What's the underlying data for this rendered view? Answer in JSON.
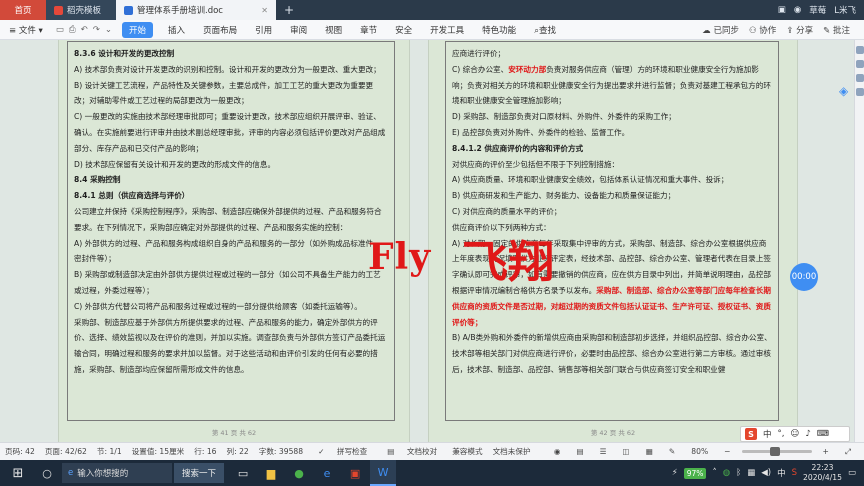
{
  "tabs": {
    "home": "首页",
    "template": "稻壳模板",
    "document": "管理体系手册培训.doc",
    "new_tab": "+"
  },
  "title_right": {
    "user": "草莓",
    "user2": "L米飞"
  },
  "ribbon": {
    "file": "文件",
    "start": "开始",
    "insert": "插入",
    "layout": "页面布局",
    "reference": "引用",
    "review": "审阅",
    "view": "视图",
    "chapter": "章节",
    "security": "安全",
    "dev_tools": "开发工具",
    "features": "特色功能",
    "search": "查找",
    "sync": "已同步",
    "collab": "协作",
    "share": "分享",
    "comment": "批注"
  },
  "page_left": {
    "lines": [
      {
        "t": "8.3.6 设计和开发的更改控制",
        "c": "h"
      },
      {
        "t": "A)  技术部负责对设计开发更改的识别和控制。设计和开发的更改分为一般更改、重大更改；"
      },
      {
        "t": "B)  设计关键工艺流程，产品特性及关键参数，主要总成件，加工工艺的重大更改为重要更改；对辅助零件或工艺过程的局部更改为一般更改；"
      },
      {
        "t": "C)  一般更改的实施由技术部经理审批即可；重要设计更改，技术部应组织开展评审、验证、确认。在实施前要进行评审并由技术副总经理审批，评审的内容必须包括评价更改对产品组成部分、库存产品和已交付产品的影响；"
      },
      {
        "t": "D)  技术部应保留有关设计和开发的更改的形成文件的信息。"
      },
      {
        "t": "8.4 采购控制",
        "c": "h"
      },
      {
        "t": "8.4.1 总则（供应商选择与评价）",
        "c": "h"
      },
      {
        "t": "    公司建立并保持《采购控制程序》，采购部、制造部应确保外部提供的过程、产品和服务符合要求。在下列情况下，采购部应确定对外部提供的过程、产品和服务实施的控制："
      },
      {
        "t": "A)  外部供方的过程、产品和服务构成组织自身的产品和服务的一部分（如外购成品标准件、密封件等）；"
      },
      {
        "t": "B)  采购部或制造部决定由外部供方提供过程或过程的一部分（如公司不具备生产能力的工艺或过程，外委过程等）；"
      },
      {
        "t": "C)  外部供方代替公司将产品和服务过程或过程的一部分提供给顾客（如委托运输等）。"
      },
      {
        "t": "    采购部、制造部应基于外部供方所提供要求的过程、产品和服务的能力，确定外部供方的评价、选择、绩效监视以及在评价的准则，并加以实施。调查部负责与外部供方签订产品委托运输合同，明确过程和服务的要求并加以监督。对于这些活动和由评价引发的任何有必要的措施，采购部、制造部均应保留所需形成文件的信息。"
      }
    ],
    "footer": "第 41 页 共 62"
  },
  "page_right": {
    "lines": [
      {
        "t": "应商进行评价；"
      },
      {
        "t": "C)  综合办公室、",
        "r": "安环动力部",
        "t2": "负责对服务供应商（管理）方的环境和职业健康安全行为施加影响；负责对相关方的环境和职业健康安全行为提出要求并进行监督；负责对基建工程承包方的环境和职业健康安全管理施加影响；"
      },
      {
        "t": "D)  采购部、制造部负责对口原材料、外购件、外委件的采购工作；"
      },
      {
        "t": "E)  品控部负责对外购件、外委件的检验、监督工作。"
      },
      {
        "t": "8.4.1.2 供应商评价的内容和评价方式",
        "c": "h"
      },
      {
        "t": "    对供应商的评价至少包括但不限于下列控制措施："
      },
      {
        "t": "A)  供应商质量、环境和职业健康安全绩效，包括体系认证情况和重大事件、投诉；"
      },
      {
        "t": "B)  供应商研发和生产能力、财务能力、设备能力和质量保证能力；"
      },
      {
        "t": "C)  对供应商的质量水平的评价；"
      },
      {
        "t": "    供应商评价以下列两种方式："
      },
      {
        "t": "A)  对长期、固定的供应商每年采取集中评审的方式，采购部、制造部、综合办公室根据供应商上年度表现情况填写供方业绩评定表，经技术部、品控部、综合办公室、管理者代表在目录上签字确认即可完成评审，如有需要撤销的供应商，应在供方目录中列出，并简单说明理由，品控部根据评审情况编制合格供方名录予以发布。",
        "r": "采购部、制造部、综合办公室等部门应每年检查长期供应商的资质文件是否过期，对超过期的资质文件包括认证证书、生产许可证、授权证书、资质评价等；"
      },
      {
        "t": "B)  A/B类外购和外委件的新增供应商由采购部和制造部初步选择，并组织品控部、综合办公室、技术部等相关部门对供应商进行评价，必要时由品控部、综合办公室进行第二方审核。通过审核后，技术部、制造部、品控部、销售部等相关部门联合与供应商签订安全和职业健"
      }
    ],
    "footer": "第 42 页 共 62"
  },
  "watermark": {
    "latin": "Fly",
    "chinese": "飞翔"
  },
  "float_button": "00:00",
  "ime": {
    "mode": "中",
    "extra": "°,"
  },
  "statusbar": {
    "page": "页码: 42",
    "pages": "页面: 42/62",
    "section": "节: 1/1",
    "setting": "设置值: 15厘米",
    "row": "行: 16",
    "col": "列: 22",
    "words": "字数: 39588",
    "spell": "拼写检查",
    "doc_check": "文档校对",
    "compat": "兼容模式",
    "protect": "文档未保护",
    "zoom": "80%",
    "zoom_level": 0.8
  },
  "taskbar": {
    "search_placeholder": "输入你想搜的",
    "search_button": "搜索一下",
    "battery": "97%",
    "time": "22:23",
    "date": "2020/4/15",
    "lang": "中"
  }
}
